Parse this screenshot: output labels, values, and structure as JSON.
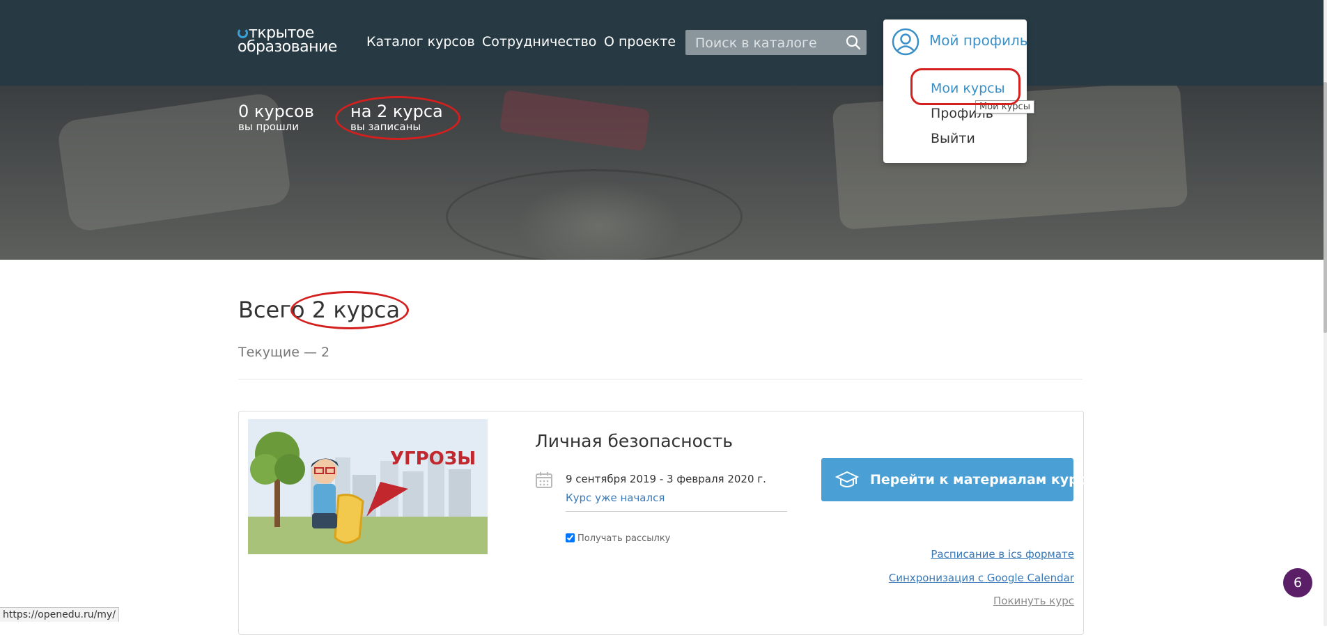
{
  "header": {
    "logo_line1": "ткрытое",
    "logo_line2": "образование",
    "nav": [
      "Каталог курсов",
      "Сотрудничество",
      "О проекте"
    ],
    "search_placeholder": "Поиск в каталоге"
  },
  "profile_menu": {
    "title": "Мой профиль",
    "items": [
      "Мои курсы",
      "Профиль",
      "Выйти"
    ],
    "tooltip": "Мои курсы"
  },
  "stats": {
    "completed_value": "0 курсов",
    "completed_label": "вы прошли",
    "enrolled_value": "на 2 курса",
    "enrolled_label": "вы записаны"
  },
  "main": {
    "heading": "Всего 2 курса",
    "current_label": "Текущие — 2"
  },
  "course": {
    "image_text": "УГРОЗЫ",
    "title": "Личная безопасность",
    "dates": "9 сентября 2019 - 3 февраля 2020 г.",
    "status": "Курс уже начался",
    "newsletter_label": "Получать рассылку",
    "newsletter_checked": true,
    "go_button": "Перейти к материалам курса",
    "link_ics": "Расписание в ics формате",
    "link_google": "Синхронизация с Google Calendar",
    "link_leave": "Покинуть курс"
  },
  "status_bar_url": "https://openedu.ru/my/",
  "notification_badge": "6",
  "colors": {
    "header_bg": "#273a44",
    "accent_blue": "#4aa0d5",
    "link_blue": "#3a79b8",
    "annotation_red": "#d41f1f",
    "badge_purple": "#5a1f67"
  }
}
